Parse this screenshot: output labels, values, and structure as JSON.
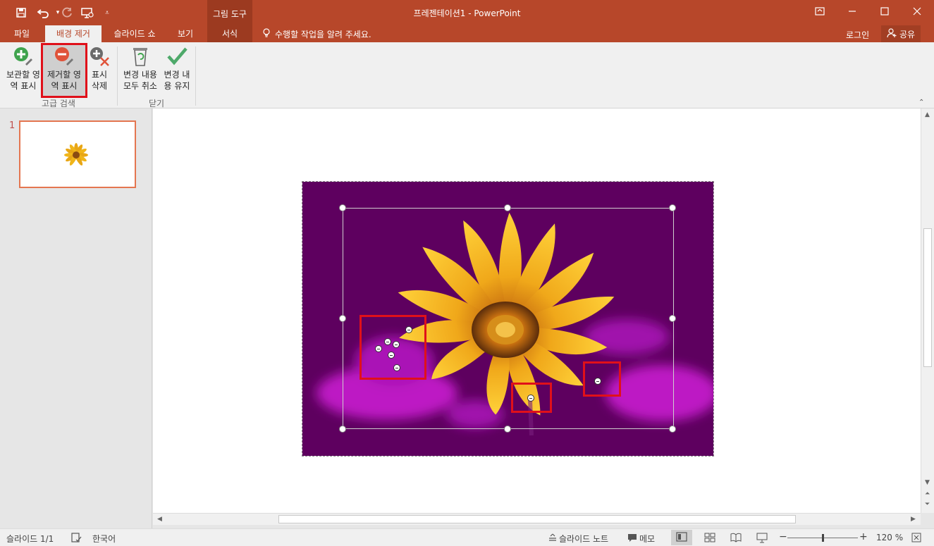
{
  "window": {
    "title": "프레젠테이션1 - PowerPoint",
    "context_tool": "그림 도구",
    "brand_color": "#b7472a"
  },
  "quick_access": {
    "icons": [
      "save-icon",
      "undo-icon",
      "redo-icon",
      "present-icon",
      "customize-icon"
    ]
  },
  "tabs": [
    {
      "label": "파일"
    },
    {
      "label": "배경 제거"
    },
    {
      "label": "슬라이드 쇼"
    },
    {
      "label": "보기"
    },
    {
      "label": "서식"
    }
  ],
  "tell_me": "수행할 작업을 알려 주세요.",
  "login": "로그인",
  "share": "공유",
  "ribbon": {
    "refine_group": {
      "label": "고급 검색",
      "keep": {
        "line1": "보관할 영",
        "line2": "역 표시"
      },
      "remove": {
        "line1": "제거할 영",
        "line2": "역 표시"
      },
      "delete": {
        "line1": "표시",
        "line2": "삭제"
      }
    },
    "close_group": {
      "label": "닫기",
      "discard": {
        "line1": "변경 내용",
        "line2": "모두 취소"
      },
      "keep_changes": {
        "line1": "변경 내",
        "line2": "용 유지"
      }
    }
  },
  "slides": {
    "number": "1"
  },
  "status": {
    "slide": "슬라이드 1/1",
    "language": "한국어",
    "notes": "슬라이드 노트",
    "comments": "메모",
    "zoom": "120 %",
    "zoom_fraction": 0.5
  }
}
